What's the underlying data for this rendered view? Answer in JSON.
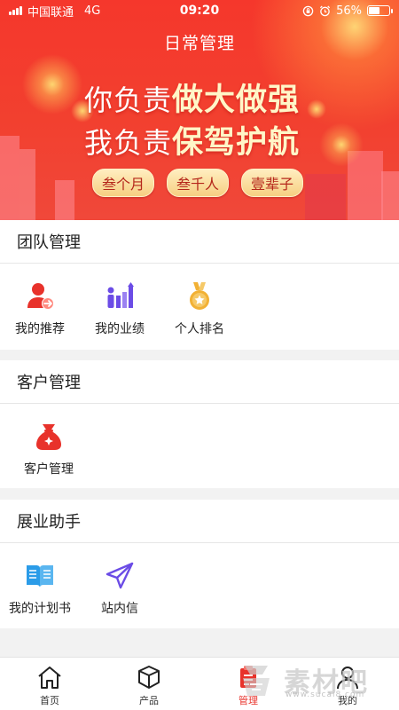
{
  "status_bar": {
    "carrier": "中国联通",
    "network": "4G",
    "time": "09:20",
    "battery": "56%",
    "battery_level": 0.56
  },
  "header": {
    "title": "日常管理",
    "slogan_line1_prefix": "你负责",
    "slogan_line1_emphasis": "做大做强",
    "slogan_line2_prefix": "我负责",
    "slogan_line2_emphasis": "保驾护航",
    "tags": [
      "叁个月",
      "叁千人",
      "壹辈子"
    ]
  },
  "sections": {
    "team": {
      "title": "团队管理",
      "items": [
        {
          "label": "我的推荐",
          "icon": "recommend-user-icon"
        },
        {
          "label": "我的业绩",
          "icon": "performance-icon"
        },
        {
          "label": "个人排名",
          "icon": "ranking-medal-icon"
        }
      ]
    },
    "customer": {
      "title": "客户管理",
      "items": [
        {
          "label": "客户管理",
          "icon": "money-bag-icon"
        }
      ]
    },
    "business": {
      "title": "展业助手",
      "items": [
        {
          "label": "我的计划书",
          "icon": "open-book-icon"
        },
        {
          "label": "站内信",
          "icon": "paper-plane-icon"
        }
      ]
    }
  },
  "tabbar": {
    "items": [
      {
        "label": "首页",
        "icon": "home-icon"
      },
      {
        "label": "产品",
        "icon": "box-icon"
      },
      {
        "label": "管理",
        "icon": "manage-icon"
      },
      {
        "label": "我的",
        "icon": "user-icon"
      }
    ],
    "active": "管理"
  },
  "colors": {
    "brand_red": "#f23a2e",
    "icon_red": "#e8322b",
    "icon_purple": "#6b4ce6",
    "icon_gold": "#f2b135",
    "icon_blue": "#2b9ce8"
  },
  "watermark": {
    "text": "素材吧",
    "site": "www.sucai8.com"
  }
}
